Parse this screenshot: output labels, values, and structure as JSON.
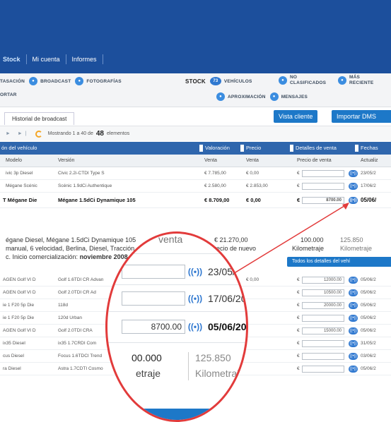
{
  "nav": {
    "items": [
      {
        "label": "Stock",
        "active": true
      },
      {
        "label": "Mi cuenta",
        "active": false
      },
      {
        "label": "Informes",
        "active": false
      }
    ]
  },
  "subbar": {
    "tasacion": "TASACIÓN",
    "broadcast": "BROADCAST",
    "fotografias": "FOTOGRAFÍAS",
    "stock": "STOCK",
    "stock_count": "73",
    "vehiculos": "VEHÍCULOS",
    "no_clasificados_1": "NO",
    "no_clasificados_2": "CLASIFICADOS",
    "mas_recientes_1": "MÁS",
    "mas_recientes_2": "RECIENTE",
    "importar": "ORTAR",
    "aproximacion": "APROXIMACIÓN",
    "mensajes": "MENSAJES"
  },
  "tabs": {
    "historial": "Historial de broadcast",
    "vista_cliente": "Vista cliente",
    "importar_dms": "Importar DMS"
  },
  "pager": {
    "arrows": "► ►|",
    "text_before": "Mostrando 1 a 40 de",
    "total": "48",
    "text_after": "elementos"
  },
  "group_headers": {
    "vehiculo": "ón del vehículo",
    "valoracion": "Valoración",
    "precio": "Precio",
    "detalles": "Detalles de venta",
    "fechas": "Fechas"
  },
  "columns": {
    "modelo": "Modelo",
    "version": "Versión",
    "venta1": "Venta",
    "venta2": "Venta",
    "precio_venta": "Precio de venta",
    "actualiz": "Actualiz"
  },
  "rows_top": [
    {
      "modelo": "ivic 3p Diesel",
      "version": "Civic 2.2i-CTDI Type S",
      "venta1": "€ 7.785,00",
      "venta2": "€ 0,00",
      "precio": "",
      "fecha": "23/05/2"
    },
    {
      "modelo": "Mégane Scénic",
      "version": "Scénic 1.9dCi Authentique",
      "venta1": "€ 2.580,00",
      "venta2": "€ 2.853,00",
      "precio": "",
      "fecha": "17/06/2"
    },
    {
      "modelo": "T Mégane Die",
      "version": "Mégane 1.5dCi Dynamique 105",
      "venta1": "€ 8.709,00",
      "venta2": "€ 0,00",
      "precio": "8700.00",
      "fecha": "05/06/"
    }
  ],
  "currency": "€",
  "signal": "((•))",
  "detail": {
    "line1": "égane Diesel, Mégane 1.5dCi Dynamique 105",
    "line2": "manual, 6 velocidad, Berlina, Diesel, Tracción",
    "line3_a": "c. Inicio comercialización:",
    "line3_b": "noviembre 2008",
    "precio_nuevo_val": "€ 21.270,00",
    "precio_nuevo_lbl": "Precio de nuevo",
    "km1_val": "100.000",
    "km1_lbl": "Kilometraje",
    "km2_val": "125.850",
    "km2_lbl": "Kilometraje",
    "todos_btn": "Todos los detalles del vehí"
  },
  "rows_bottom": [
    {
      "modelo": "AGEN Golf VI D",
      "version": "Golf 1.6TDI CR Advan",
      "venta2": "€ 0,00",
      "precio": "12000.00",
      "fecha": "05/06/2"
    },
    {
      "modelo": "AGEN Golf VI D",
      "version": "Golf 2.0TDI CR Ad",
      "venta2": "",
      "precio": "10500.00",
      "fecha": "05/06/2"
    },
    {
      "modelo": "ie 1 F20 5p Die",
      "version": "118d",
      "venta2": "",
      "precio": "20000.00",
      "fecha": "05/06/2"
    },
    {
      "modelo": "ie 1 F20 5p Die",
      "version": "120d Urban",
      "venta2": "",
      "precio": "",
      "fecha": "05/06/2"
    },
    {
      "modelo": "AGEN Golf VI D",
      "version": "Golf 2.0TDI CRA",
      "venta2": "",
      "precio": "15000.00",
      "fecha": "05/06/2"
    },
    {
      "modelo": "ix35 Diesel",
      "version": "ix35 1.7CRDI Com",
      "venta2": "",
      "precio": "",
      "fecha": "31/05/2"
    },
    {
      "modelo": "cus Diesel",
      "version": "Focus 1.6TDCI Trend",
      "venta2": "",
      "precio": "",
      "fecha": "03/06/2"
    },
    {
      "modelo": "ra Diesel",
      "version": "Astra 1.7CDTI Cosmo",
      "venta2": "",
      "precio": "",
      "fecha": "05/06/2"
    }
  ],
  "zoom": {
    "header_left": "venta",
    "header_right": "Ac",
    "date1": "23/05/20",
    "date2": "17/06/2013",
    "price3": "8700.00",
    "date3": "05/06/20",
    "km1_val": "00.000",
    "km1_lbl": "etraje",
    "km2_val": "125.850",
    "km2_lbl": "Kilometraje"
  }
}
